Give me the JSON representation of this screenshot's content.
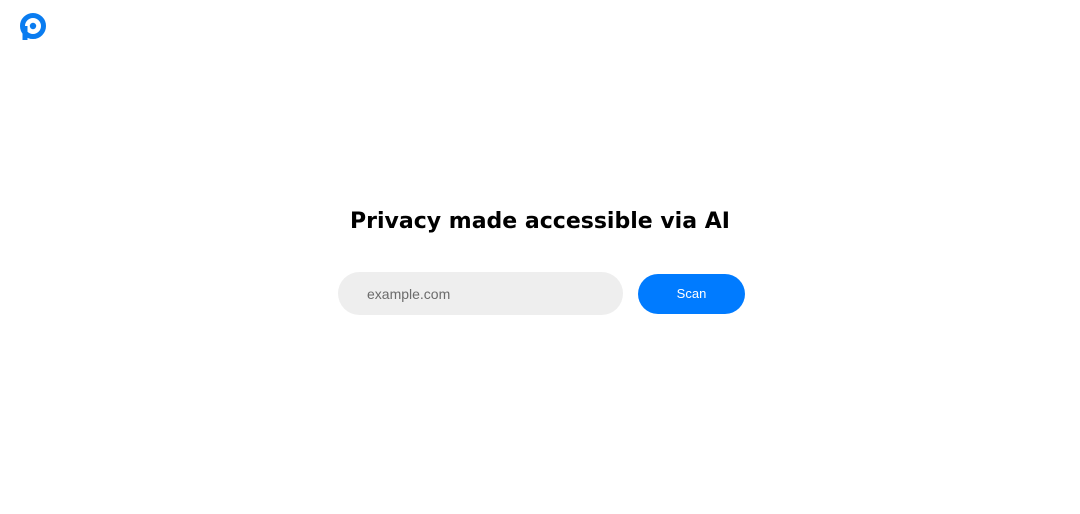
{
  "header": {
    "logo_icon": "p-logo-icon",
    "brand_color": "#0a7cf0"
  },
  "hero": {
    "title": "Privacy made accessible via AI"
  },
  "scan_form": {
    "input_value": "",
    "input_placeholder": "example.com",
    "button_label": "Scan",
    "button_color": "#007bff",
    "input_background": "#eeeeee"
  }
}
